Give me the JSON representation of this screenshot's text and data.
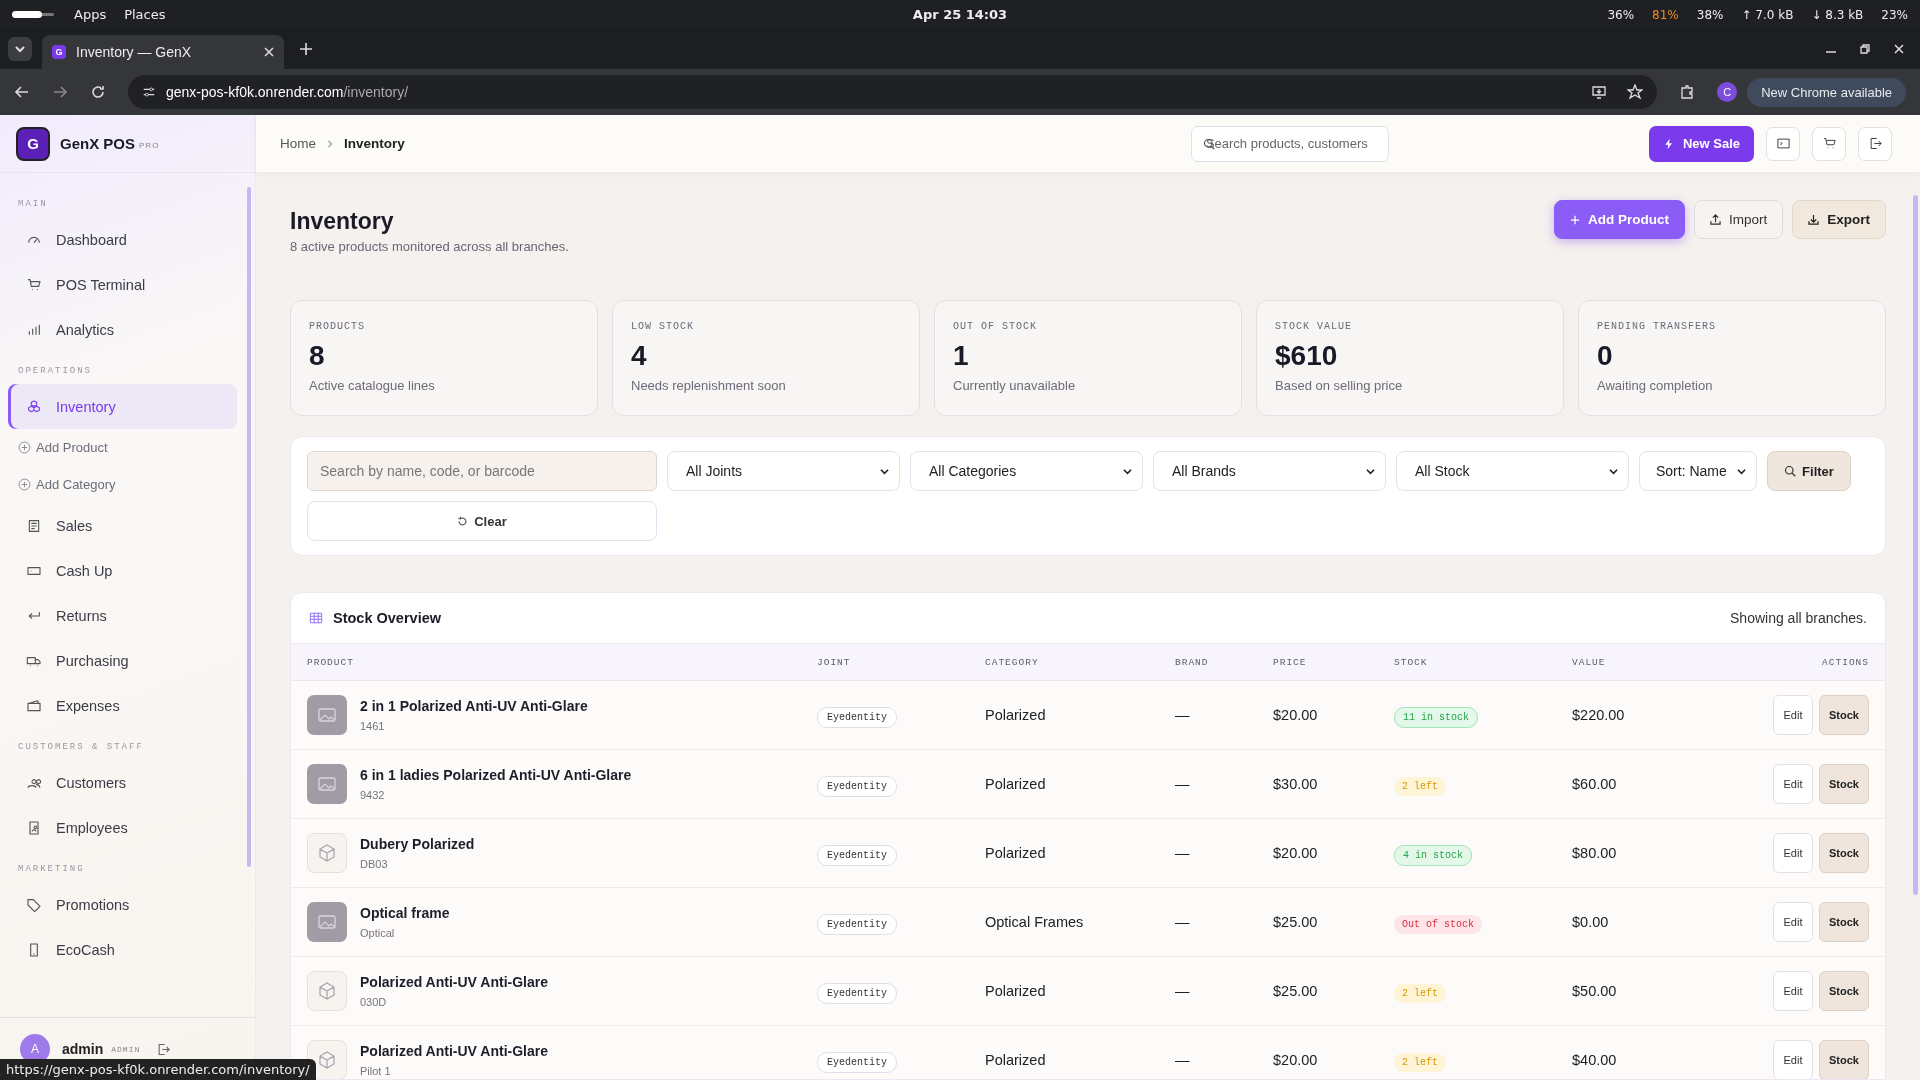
{
  "os_bar": {
    "menus": [
      "Apps",
      "Places"
    ],
    "clock": "Apr 25  14:03",
    "indicators": [
      {
        "text": "36%",
        "kind": "normal"
      },
      {
        "text": "81%",
        "kind": "warn"
      },
      {
        "text": "38%",
        "kind": "normal"
      },
      {
        "text": "↑ 7.0 kB",
        "kind": "normal"
      },
      {
        "text": "↓ 8.3 kB",
        "kind": "normal"
      },
      {
        "text": "23%",
        "kind": "normal"
      }
    ]
  },
  "browser": {
    "tab": {
      "title": "Inventory — GenX",
      "favicon": "G"
    },
    "url_host": "genx-pos-kf0k.onrender.com",
    "url_path": "/inventory/",
    "profile": "C",
    "update": "New Chrome available"
  },
  "sidebar": {
    "logo": "G",
    "brand": "GenX POS",
    "badge": "PRO",
    "sections": [
      {
        "label": "MAIN",
        "items": [
          {
            "label": "Dashboard",
            "kind": "main",
            "selected": false
          },
          {
            "label": "POS Terminal",
            "kind": "main",
            "selected": false
          },
          {
            "label": "Analytics",
            "kind": "main",
            "selected": false
          }
        ]
      },
      {
        "label": "OPERATIONS",
        "items": [
          {
            "label": "Inventory",
            "kind": "main",
            "selected": true
          },
          {
            "label": "Add Product",
            "kind": "sub",
            "selected": false
          },
          {
            "label": "Add Category",
            "kind": "sub",
            "selected": false
          },
          {
            "label": "Sales",
            "kind": "main",
            "selected": false
          },
          {
            "label": "Cash Up",
            "kind": "main",
            "selected": false
          },
          {
            "label": "Returns",
            "kind": "main",
            "selected": false
          },
          {
            "label": "Purchasing",
            "kind": "main",
            "selected": false
          },
          {
            "label": "Expenses",
            "kind": "main",
            "selected": false
          }
        ]
      },
      {
        "label": "CUSTOMERS & STAFF",
        "items": [
          {
            "label": "Customers",
            "kind": "main",
            "selected": false
          },
          {
            "label": "Employees",
            "kind": "main",
            "selected": false
          }
        ]
      },
      {
        "label": "MARKETING",
        "items": [
          {
            "label": "Promotions",
            "kind": "main",
            "selected": false
          },
          {
            "label": "EcoCash",
            "kind": "main",
            "selected": false
          }
        ]
      }
    ],
    "user": {
      "avatar": "A",
      "name": "admin",
      "role": "ADMIN"
    }
  },
  "header": {
    "breadcrumb": [
      "Home",
      "Inventory"
    ],
    "search_placeholder": "Search products, customers",
    "new_sale": "New Sale"
  },
  "page": {
    "title": "Inventory",
    "subtitle": "8 active products monitored across all branches.",
    "actions": [
      {
        "label": "Add Product",
        "kind": "primary"
      },
      {
        "label": "Import",
        "kind": "plain"
      },
      {
        "label": "Export",
        "kind": "tinted"
      }
    ]
  },
  "stats": [
    {
      "label": "PRODUCTS",
      "value": "8",
      "note": "Active catalogue lines"
    },
    {
      "label": "LOW STOCK",
      "value": "4",
      "note": "Needs replenishment soon"
    },
    {
      "label": "OUT OF STOCK",
      "value": "1",
      "note": "Currently unavailable"
    },
    {
      "label": "STOCK VALUE",
      "value": "$610",
      "note": "Based on selling price"
    },
    {
      "label": "PENDING TRANSFERS",
      "value": "0",
      "note": "Awaiting completion"
    }
  ],
  "filters": {
    "search_placeholder": "Search by name, code, or barcode",
    "selects": [
      {
        "value": "All Joints",
        "kind": "wide"
      },
      {
        "value": "All Categories",
        "kind": "wide"
      },
      {
        "value": "All Brands",
        "kind": "wide"
      },
      {
        "value": "All Stock",
        "kind": "wide"
      },
      {
        "value": "Sort: Name",
        "kind": "narrow"
      }
    ],
    "filter_button": "Filter",
    "clear_button": "Clear"
  },
  "table": {
    "title": "Stock Overview",
    "note": "Showing all branches.",
    "columns": [
      "PRODUCT",
      "JOINT",
      "CATEGORY",
      "BRAND",
      "PRICE",
      "STOCK",
      "VALUE",
      "ACTIONS"
    ],
    "rows": [
      {
        "name": "2 in 1 Polarized Anti-UV Anti-Glare",
        "code": "1461",
        "kind": "image",
        "joint": "Eyedentity",
        "category": "Polarized",
        "brand": "—",
        "price": "$20.00",
        "stock": {
          "label": "11 in stock",
          "kind": "ok"
        },
        "value": "$220.00",
        "actions": [
          "Edit",
          "Stock"
        ]
      },
      {
        "name": "6 in 1 ladies Polarized Anti-UV Anti-Glare",
        "code": "9432",
        "kind": "image",
        "joint": "Eyedentity",
        "category": "Polarized",
        "brand": "—",
        "price": "$30.00",
        "stock": {
          "label": "2 left",
          "kind": "low"
        },
        "value": "$60.00",
        "actions": [
          "Edit",
          "Stock"
        ]
      },
      {
        "name": "Dubery Polarized",
        "code": "DB03",
        "kind": "box",
        "joint": "Eyedentity",
        "category": "Polarized",
        "brand": "—",
        "price": "$20.00",
        "stock": {
          "label": "4 in stock",
          "kind": "ok"
        },
        "value": "$80.00",
        "actions": [
          "Edit",
          "Stock"
        ]
      },
      {
        "name": "Optical frame",
        "code": "Optical",
        "kind": "image",
        "joint": "Eyedentity",
        "category": "Optical Frames",
        "brand": "—",
        "price": "$25.00",
        "stock": {
          "label": "Out of stock",
          "kind": "out"
        },
        "value": "$0.00",
        "actions": [
          "Edit",
          "Stock"
        ]
      },
      {
        "name": "Polarized Anti-UV Anti-Glare",
        "code": "030D",
        "kind": "box",
        "joint": "Eyedentity",
        "category": "Polarized",
        "brand": "—",
        "price": "$25.00",
        "stock": {
          "label": "2 left",
          "kind": "low"
        },
        "value": "$50.00",
        "actions": [
          "Edit",
          "Stock"
        ]
      },
      {
        "name": "Polarized Anti-UV Anti-Glare",
        "code": "Pilot 1",
        "kind": "box",
        "joint": "Eyedentity",
        "category": "Polarized",
        "brand": "—",
        "price": "$20.00",
        "stock": {
          "label": "2 left",
          "kind": "low"
        },
        "value": "$40.00",
        "actions": [
          "Edit",
          "Stock"
        ]
      }
    ]
  },
  "status_url": "https://genx-pos-kf0k.onrender.com/inventory/"
}
